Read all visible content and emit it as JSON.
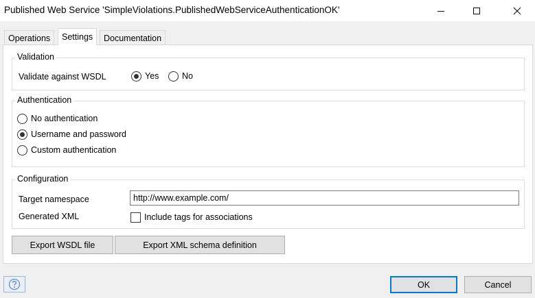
{
  "window": {
    "title": "Published Web Service 'SimpleViolations.PublishedWebServiceAuthenticationOK'",
    "icons": {
      "minimize": "minimize-icon",
      "maximize": "maximize-icon",
      "close": "close-icon"
    }
  },
  "tabs": [
    {
      "label": "Operations",
      "active": false
    },
    {
      "label": "Settings",
      "active": true
    },
    {
      "label": "Documentation",
      "active": false
    }
  ],
  "validation": {
    "title": "Validation",
    "label": "Validate against WSDL",
    "options": [
      {
        "label": "Yes",
        "selected": true
      },
      {
        "label": "No",
        "selected": false
      }
    ]
  },
  "authentication": {
    "title": "Authentication",
    "options": [
      {
        "label": "No authentication",
        "selected": false
      },
      {
        "label": "Username and password",
        "selected": true
      },
      {
        "label": "Custom authentication",
        "selected": false
      }
    ]
  },
  "configuration": {
    "title": "Configuration",
    "namespace_label": "Target namespace",
    "namespace_value": "http://www.example.com/",
    "xml_label": "Generated XML",
    "xml_checkbox_label": "Include tags for associations",
    "xml_checkbox_checked": false
  },
  "buttons": {
    "export_wsdl": "Export WSDL file",
    "export_xsd": "Export XML schema definition",
    "ok": "OK",
    "cancel": "Cancel",
    "help_icon": "help-icon"
  },
  "colors": {
    "accent": "#0078d7",
    "window_bg": "#f0f0f0",
    "panel_bg": "#ffffff",
    "help_icon": "#6a8fbf"
  }
}
